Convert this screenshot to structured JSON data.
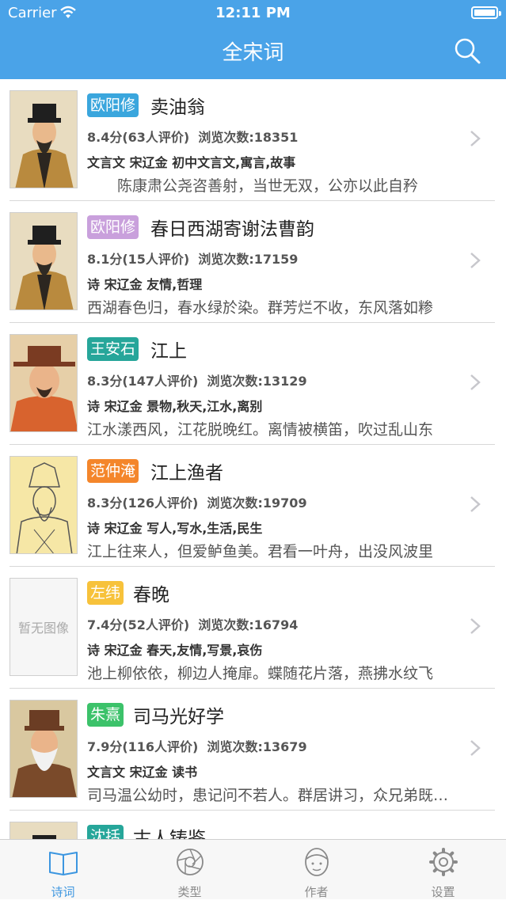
{
  "status_bar": {
    "carrier": "Carrier",
    "time": "12:11 PM"
  },
  "nav": {
    "title": "全宋词"
  },
  "colors": {
    "brand": "#4aa3e8",
    "tab_active": "#3c96e0"
  },
  "poems": [
    {
      "author": "欧阳修",
      "badge_color": "#3aa6dd",
      "title": "卖油翁",
      "rating": "8.4分(63人评价)  浏览次数:18351",
      "tags": "文言文 宋辽金 初中文言文,寓言,故事",
      "excerpt": "　　陈康肃公尧咨善射，当世无双，公亦以此自矜",
      "portrait": "scholar-black-hat"
    },
    {
      "author": "欧阳修",
      "badge_color": "#c9a0dc",
      "title": "春日西湖寄谢法曹韵",
      "rating": "8.1分(15人评价)  浏览次数:17159",
      "tags": "诗 宋辽金 友情,哲理",
      "excerpt": "西湖春色归，春水绿於染。群芳烂不收，东风落如糁",
      "portrait": "scholar-black-hat"
    },
    {
      "author": "王安石",
      "badge_color": "#26a69a",
      "title": "江上",
      "rating": "8.3分(147人评价)  浏览次数:13129",
      "tags": "诗 宋辽金 景物,秋天,江水,离别",
      "excerpt": "江水漾西风，江花脱晚红。离情被横笛，吹过乱山东",
      "portrait": "official-red-robe"
    },
    {
      "author": "范仲淹",
      "badge_color": "#f4862b",
      "title": "江上渔者",
      "rating": "8.3分(126人评价)  浏览次数:19709",
      "tags": "诗 宋辽金 写人,写水,生活,民生",
      "excerpt": "江上往来人，但爱鲈鱼美。君看一叶舟，出没风波里",
      "portrait": "line-drawing-official"
    },
    {
      "author": "左纬",
      "badge_color": "#f7c23b",
      "title": "春晚",
      "rating": "7.4分(52人评价)  浏览次数:16794",
      "tags": "诗 宋辽金 春天,友情,写景,哀伤",
      "excerpt": "池上柳依依，柳边人掩扉。蝶随花片落，燕拂水纹飞",
      "portrait_placeholder": "暂无图像"
    },
    {
      "author": "朱熹",
      "badge_color": "#3cc26a",
      "title": "司马光好学",
      "rating": "7.9分(116人评价)  浏览次数:13679",
      "tags": "文言文 宋辽金 读书",
      "excerpt": "司马温公幼时，患记问不若人。群居讲习，众兄弟既成诵",
      "portrait": "elder-white-beard"
    },
    {
      "author": "沈括",
      "badge_color": "#26a69a",
      "title": "古人铸鉴",
      "rating": "",
      "tags": "",
      "excerpt": "",
      "portrait": "scholar-black-hat"
    }
  ],
  "tabs": [
    {
      "label": "诗词",
      "icon": "book-icon",
      "active": true
    },
    {
      "label": "类型",
      "icon": "aperture-icon",
      "active": false
    },
    {
      "label": "作者",
      "icon": "person-icon",
      "active": false
    },
    {
      "label": "设置",
      "icon": "gear-icon",
      "active": false
    }
  ]
}
